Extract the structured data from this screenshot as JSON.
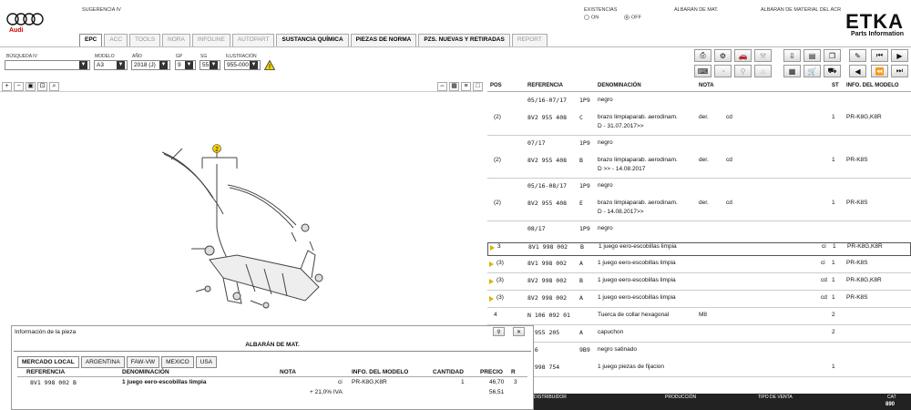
{
  "header": {
    "brand": "Audi",
    "suggestion_label": "SUGERENCIA IV",
    "stock_label": "EXISTENCIAS",
    "stock_on": "ON",
    "stock_off": "OFF",
    "delivery_label": "ALBARÁN DE MAT.",
    "delivery_acr_label": "ALBARÁN DE MATERIAL DEL ACR",
    "etka_title": "ETKA",
    "etka_subtitle": "Parts Information"
  },
  "tabs": [
    {
      "label": "EPC",
      "state": "active"
    },
    {
      "label": "ACC",
      "state": "disabled"
    },
    {
      "label": "TOOLS",
      "state": "disabled"
    },
    {
      "label": "NORA",
      "state": "disabled"
    },
    {
      "label": "INFOLINE",
      "state": "disabled"
    },
    {
      "label": "AUTOPART",
      "state": "disabled"
    },
    {
      "label": "SUSTANCIA QUÍMICA",
      "state": "enabled"
    },
    {
      "label": "PIEZAS DE NORMA",
      "state": "enabled"
    },
    {
      "label": "PZS. NUEVAS Y RETIRADAS",
      "state": "enabled"
    },
    {
      "label": "REPORT",
      "state": "disabled"
    }
  ],
  "filters": {
    "search_label": "BÚSQUEDA IV",
    "search_value": "",
    "model_label": "MODELO",
    "model_value": "A3",
    "year_label": "AÑO",
    "year_value": "2018 (J)",
    "gp_label": "GP",
    "gp_value": "9",
    "sg_label": "SG",
    "sg_value": "55",
    "illustration_label": "ILUSTRACIÓN",
    "illustration_value": "955-000"
  },
  "columns": {
    "pos": "POS",
    "ref": "REFERENCIA",
    "den": "DENOMINACIÓN",
    "nota": "NOTA",
    "st": "ST",
    "info": "INFO. DEL MODELO"
  },
  "rows": [
    {
      "pos": "",
      "ref": "05/16-07/17",
      "code": "1P9",
      "den": "negro",
      "den2": "",
      "nota": "",
      "nota2": "",
      "st": "",
      "info": "",
      "marker": false
    },
    {
      "pos": "(2)",
      "ref": "8V2 955 408",
      "code": "C",
      "den": "brazo limpiaparab. aerodinam.",
      "den2": "D - 31.07.2017>>",
      "nota": "der.",
      "nota2": "cd",
      "st": "1",
      "info": "PR-K8G,K8R",
      "marker": false
    },
    {
      "pos": "",
      "ref": "07/17",
      "code": "1P9",
      "den": "negro",
      "den2": "",
      "nota": "",
      "nota2": "",
      "st": "",
      "info": "",
      "marker": false
    },
    {
      "pos": "(2)",
      "ref": "8V2 955 408",
      "code": "B",
      "den": "brazo limpiaparab. aerodinam.",
      "den2": "D           >> - 14.08.2017",
      "nota": "der.",
      "nota2": "cd",
      "st": "1",
      "info": "PR-K8S",
      "marker": false
    },
    {
      "pos": "",
      "ref": "05/16-08/17",
      "code": "1P9",
      "den": "negro",
      "den2": "",
      "nota": "",
      "nota2": "",
      "st": "",
      "info": "",
      "marker": false
    },
    {
      "pos": "(2)",
      "ref": "8V2 955 408",
      "code": "E",
      "den": "brazo limpiaparab. aerodinam.",
      "den2": "D - 14.08.2017>>",
      "nota": "der.",
      "nota2": "cd",
      "st": "1",
      "info": "PR-K8S",
      "marker": false
    },
    {
      "pos": "",
      "ref": "08/17",
      "code": "1P9",
      "den": "negro",
      "den2": "",
      "nota": "",
      "nota2": "",
      "st": "",
      "info": "",
      "marker": false
    },
    {
      "pos": "3",
      "ref": "8V1 998 002",
      "code": "B",
      "den": "1 juego eero-escobillas limpia",
      "den2": "",
      "nota": "",
      "nota2": "ci",
      "st": "1",
      "info": "PR-K8G,K8R",
      "marker": true
    },
    {
      "pos": "(3)",
      "ref": "8V1 998 002",
      "code": "A",
      "den": "1 juego eero-escobillas limpia",
      "den2": "",
      "nota": "",
      "nota2": "ci",
      "st": "1",
      "info": "PR-K8S",
      "marker": true
    },
    {
      "pos": "(3)",
      "ref": "8V2 998 002",
      "code": "B",
      "den": "1 juego eero-escobillas limpia",
      "den2": "",
      "nota": "",
      "nota2": "cd",
      "st": "1",
      "info": "PR-K8G,K8R",
      "marker": true
    },
    {
      "pos": "(3)",
      "ref": "8V2 998 002",
      "code": "A",
      "den": "1 juego eero-escobillas limpia",
      "den2": "",
      "nota": "",
      "nota2": "cd",
      "st": "1",
      "info": "PR-K8S",
      "marker": true
    },
    {
      "pos": "4",
      "ref": "N    106 092 01",
      "code": "",
      "den": "Tuerca de collar hexagonal",
      "den2": "",
      "nota": "M8",
      "nota2": "",
      "st": "2",
      "info": "",
      "marker": false
    },
    {
      "pos": "",
      "ref": "0 955 205",
      "code": "A",
      "den": "capuchon",
      "den2": "",
      "nota": "",
      "nota2": "",
      "st": "2",
      "info": "",
      "marker": false
    },
    {
      "pos": "",
      "ref": "/16",
      "code": "9B9",
      "den": "negro satinado",
      "den2": "",
      "nota": "",
      "nota2": "",
      "st": "",
      "info": "",
      "marker": false
    },
    {
      "pos": "",
      "ref": "0 998 754",
      "code": "",
      "den": "1 juego piezas de fijacion",
      "den2": "",
      "nota": "",
      "nota2": "",
      "st": "1",
      "info": "",
      "marker": false
    }
  ],
  "diagram": {
    "callout": "2"
  },
  "panel": {
    "title": "Información de la pieza",
    "section": "ALBARÁN DE MAT.",
    "subtabs": [
      "MERCADO LOCAL",
      "ARGENTINA",
      "FAW-VW",
      "MEXICO",
      "USA"
    ],
    "headers": {
      "ref": "REFERENCIA",
      "den": "DENOMINACIÓN",
      "nota": "NOTA",
      "info": "INFO. DEL MODELO",
      "qty": "CANTIDAD",
      "price": "PRECIO",
      "r": "R"
    },
    "row": {
      "ref": "8V1 998 002 B",
      "den": "1 juego eero-escobillas limpia",
      "nota": "ci",
      "info": "PR-K8G,K8R",
      "qty": "1",
      "price": "46,70",
      "r": "3"
    },
    "vat_label": "+ 21,0% IVA",
    "total": "56,51"
  },
  "statusbar": {
    "dealer": "DISTRIBUIDOR",
    "production": "PRODUCCIÓN",
    "sale_type": "TIPO DE VENTA",
    "cat_label": "CAT",
    "cat_value": "890"
  },
  "colors": {
    "marker": "#d8b400",
    "brand": "#c00000"
  }
}
